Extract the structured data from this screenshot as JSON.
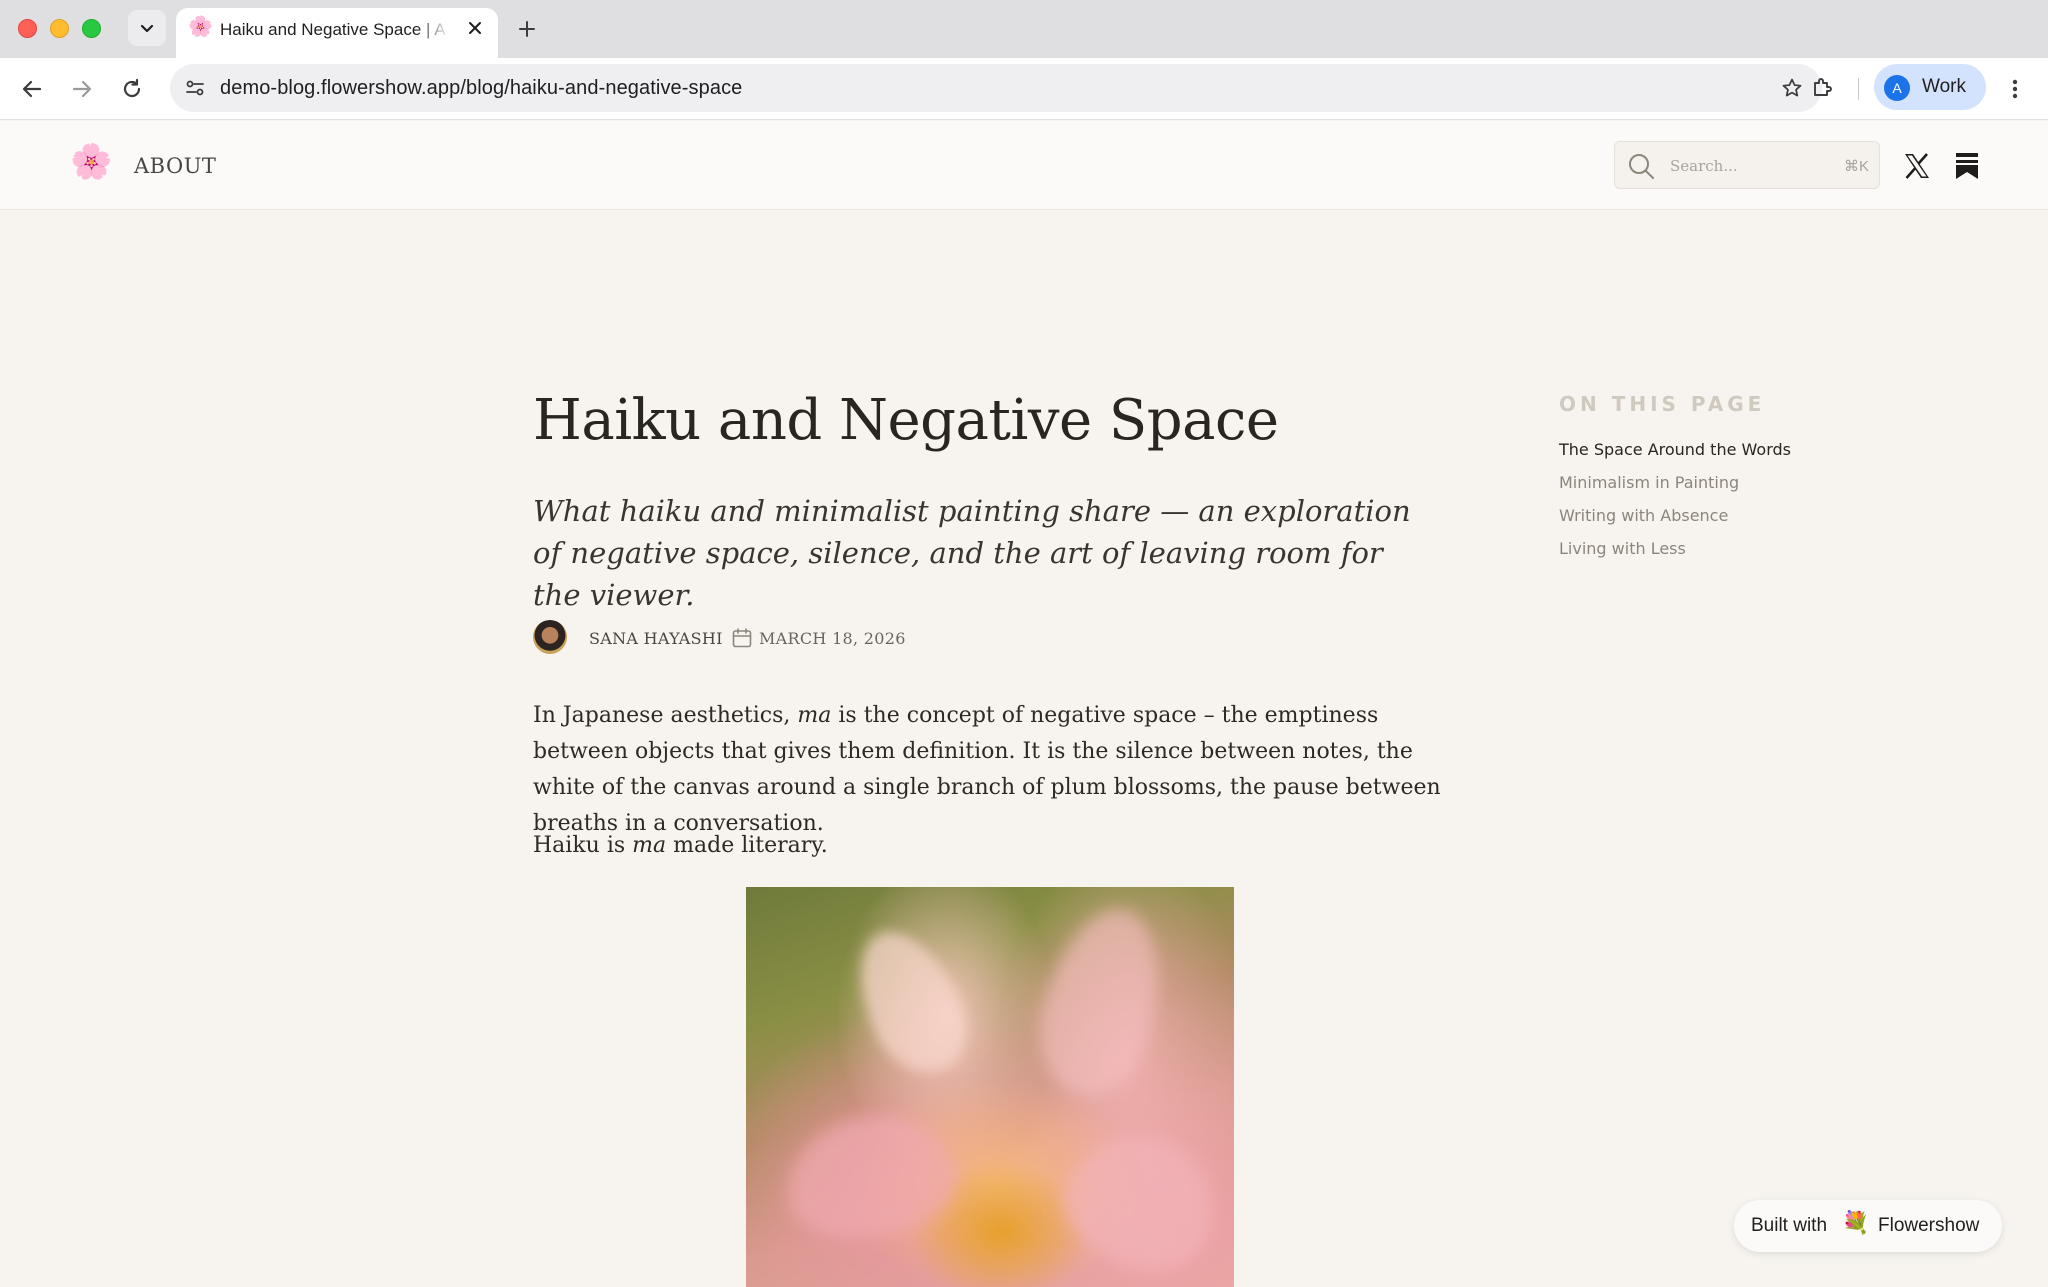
{
  "browser": {
    "tab": {
      "favicon": "🌸",
      "title": "Haiku and Negative Space | A"
    },
    "url": "demo-blog.flowershow.app/blog/haiku-and-negative-space",
    "profile": {
      "initial": "A",
      "name": "Work"
    },
    "icons": [
      "chevron-down-icon",
      "close-icon",
      "plus-icon",
      "back-arrow-icon",
      "forward-arrow-icon",
      "reload-icon",
      "site-info-icon",
      "star-icon",
      "extensions-icon",
      "kebab-menu-icon"
    ]
  },
  "site": {
    "logo": "🌸",
    "nav": {
      "about": "ABOUT"
    },
    "search": {
      "placeholder": "Search...",
      "shortcut": "⌘K"
    }
  },
  "article": {
    "title": "Haiku and Negative Space",
    "subtitle": "What haiku and minimalist painting share — an exploration of negative space, silence, and the art of leaving room for the viewer.",
    "author": "SANA HAYASHI",
    "date": "MARCH 18, 2026",
    "p1": {
      "before": "In Japanese aesthetics, ",
      "em": "ma",
      "after": " is the concept of negative space – the emptiness between objects that gives them definition. It is the silence between notes, the white of the canvas around a single branch of plum blossoms, the pause between breaths in a conversation."
    },
    "p2": {
      "before": "Haiku is ",
      "em": "ma",
      "after": " made literary."
    }
  },
  "toc": {
    "heading": "ON THIS PAGE",
    "items": [
      {
        "label": "The Space Around the Words",
        "active": true
      },
      {
        "label": "Minimalism in Painting",
        "active": false
      },
      {
        "label": "Writing with Absence",
        "active": false
      },
      {
        "label": "Living with Less",
        "active": false
      }
    ]
  },
  "badge": {
    "left": "Built with",
    "logo": "💐",
    "right": "Flowershow"
  }
}
